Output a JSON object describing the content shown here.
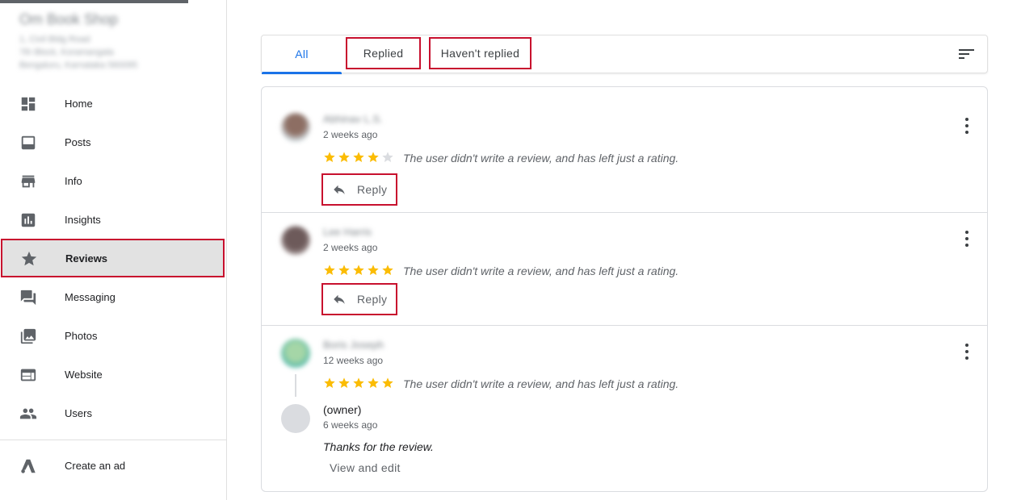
{
  "business": {
    "name": "Om Book Shop",
    "address_lines": [
      "1, Civil Bldg Road",
      "7th Block, Koramangala",
      "Bengaluru, Karnataka 560095"
    ]
  },
  "sidebar": {
    "items": [
      {
        "label": "Home",
        "icon": "dashboard-icon"
      },
      {
        "label": "Posts",
        "icon": "posts-icon"
      },
      {
        "label": "Info",
        "icon": "store-icon"
      },
      {
        "label": "Insights",
        "icon": "insights-icon"
      },
      {
        "label": "Reviews",
        "icon": "star-icon",
        "active": true
      },
      {
        "label": "Messaging",
        "icon": "messaging-icon"
      },
      {
        "label": "Photos",
        "icon": "photos-icon"
      },
      {
        "label": "Website",
        "icon": "website-icon"
      },
      {
        "label": "Users",
        "icon": "users-icon"
      }
    ],
    "bottom_items": [
      {
        "label": "Create an ad",
        "icon": "ads-icon"
      }
    ]
  },
  "tabs": {
    "all": "All",
    "replied": "Replied",
    "not_replied": "Haven't replied",
    "active": "all"
  },
  "reviews": [
    {
      "name": "Abhinav L.S.",
      "time": "2 weeks ago",
      "rating": 4,
      "text": "The user didn't write a review, and has left just a rating.",
      "reply_label": "Reply"
    },
    {
      "name": "Lee Harris",
      "time": "2 weeks ago",
      "rating": 5,
      "text": "The user didn't write a review, and has left just a rating.",
      "reply_label": "Reply"
    },
    {
      "name": "Boris Joseph",
      "time": "12 weeks ago",
      "rating": 5,
      "text": "The user didn't write a review, and has left just a rating.",
      "owner_reply": {
        "name": "(owner)",
        "time": "6 weeks ago",
        "text": "Thanks for the review.",
        "action": "View and edit"
      }
    }
  ],
  "colors": {
    "accent": "#1a73e8",
    "star": "#fbbc04",
    "star_empty": "#dadce0",
    "highlight_border": "#c8102e"
  }
}
